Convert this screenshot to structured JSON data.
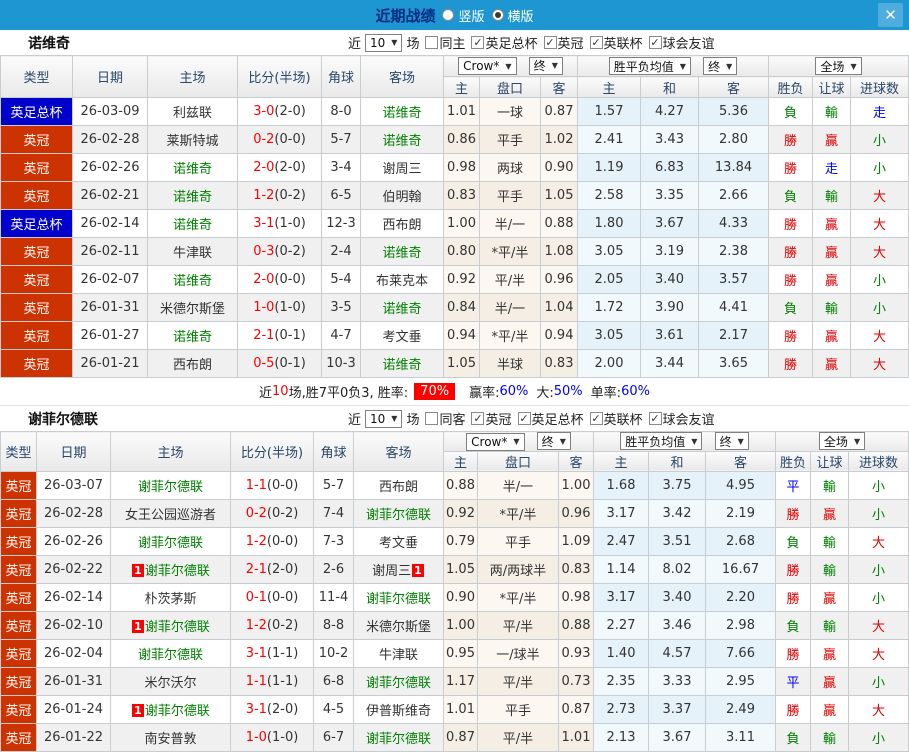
{
  "titlebar": {
    "title": "近期战绩",
    "vertical_label": "竖版",
    "horizontal_label": "横版",
    "selected_layout": "横版"
  },
  "icons": {
    "close": "✕",
    "dropdown_arrow": "▼",
    "check": "✓"
  },
  "colors": {
    "titlebar_blue": "#1e96d2",
    "league_badge_red": "#cc3301",
    "cup_badge_blue": "#0000cc",
    "self_team_green": "#008000",
    "score_red": "#ff0000",
    "win_red": "#e60000",
    "lose_green": "#008000",
    "draw_blue": "#0000ff",
    "rate_value_blue": "#0000ff",
    "win_rate_bg_red": "#ff0000"
  },
  "sections": [
    {
      "team": "诺维奇",
      "filter": {
        "near_label": "近",
        "count": "10",
        "games_label": "场",
        "same_label": "同主",
        "same_checked": false,
        "competitions": [
          "英足总杯",
          "英冠",
          "英联杯",
          "球会友谊"
        ]
      },
      "header": {
        "type": "类型",
        "date": "日期",
        "home": "主场",
        "score": "比分(半场)",
        "corner": "角球",
        "away": "客场",
        "asia_provider": "Crow*",
        "asia_stage": "终",
        "europe_provider": "胜平负均值",
        "europe_stage": "终",
        "scope": "全场",
        "asia_home": "主",
        "asia_handicap": "盘口",
        "asia_away": "客",
        "eu_home": "主",
        "eu_draw": "和",
        "eu_away": "客",
        "outcome": "胜负",
        "handicap_result": "让球",
        "goals": "进球数"
      },
      "rows": [
        {
          "league": "英足总杯",
          "league_type": "cup",
          "date": "26-03-09",
          "home": "利兹联",
          "home_self": false,
          "home_card": "",
          "score_ft": "3-0",
          "score_ht": "(2-0)",
          "corners": "8-0",
          "away": "诺维奇",
          "away_self": true,
          "away_card": "",
          "asia": [
            "1.01",
            "一球",
            "0.87"
          ],
          "europe": [
            "1.57",
            "4.27",
            "5.36"
          ],
          "results": [
            [
              "負",
              "green"
            ],
            [
              "輸",
              "green"
            ],
            [
              "走",
              "blue"
            ]
          ]
        },
        {
          "league": "英冠",
          "league_type": "league",
          "date": "26-02-28",
          "home": "莱斯特城",
          "home_self": false,
          "home_card": "",
          "score_ft": "0-2",
          "score_ht": "(0-0)",
          "corners": "5-7",
          "away": "诺维奇",
          "away_self": true,
          "away_card": "",
          "asia": [
            "0.86",
            "平手",
            "1.02"
          ],
          "europe": [
            "2.41",
            "3.43",
            "2.80"
          ],
          "results": [
            [
              "勝",
              "red"
            ],
            [
              "贏",
              "red"
            ],
            [
              "小",
              "green"
            ]
          ]
        },
        {
          "league": "英冠",
          "league_type": "league",
          "date": "26-02-26",
          "home": "诺维奇",
          "home_self": true,
          "home_card": "",
          "score_ft": "2-0",
          "score_ht": "(2-0)",
          "corners": "3-4",
          "away": "谢周三",
          "away_self": false,
          "away_card": "",
          "asia": [
            "0.98",
            "两球",
            "0.90"
          ],
          "europe": [
            "1.19",
            "6.83",
            "13.84"
          ],
          "results": [
            [
              "勝",
              "red"
            ],
            [
              "走",
              "blue"
            ],
            [
              "小",
              "green"
            ]
          ]
        },
        {
          "league": "英冠",
          "league_type": "league",
          "date": "26-02-21",
          "home": "诺维奇",
          "home_self": true,
          "home_card": "",
          "score_ft": "1-2",
          "score_ht": "(0-2)",
          "corners": "6-5",
          "away": "伯明翰",
          "away_self": false,
          "away_card": "",
          "asia": [
            "0.83",
            "平手",
            "1.05"
          ],
          "europe": [
            "2.58",
            "3.35",
            "2.66"
          ],
          "results": [
            [
              "負",
              "green"
            ],
            [
              "輸",
              "green"
            ],
            [
              "大",
              "red"
            ]
          ]
        },
        {
          "league": "英足总杯",
          "league_type": "cup",
          "date": "26-02-14",
          "home": "诺维奇",
          "home_self": true,
          "home_card": "",
          "score_ft": "3-1",
          "score_ht": "(1-0)",
          "corners": "12-3",
          "away": "西布朗",
          "away_self": false,
          "away_card": "",
          "asia": [
            "1.00",
            "半/一",
            "0.88"
          ],
          "europe": [
            "1.80",
            "3.67",
            "4.33"
          ],
          "results": [
            [
              "勝",
              "red"
            ],
            [
              "贏",
              "red"
            ],
            [
              "大",
              "red"
            ]
          ]
        },
        {
          "league": "英冠",
          "league_type": "league",
          "date": "26-02-11",
          "home": "牛津联",
          "home_self": false,
          "home_card": "",
          "score_ft": "0-3",
          "score_ht": "(0-2)",
          "corners": "2-4",
          "away": "诺维奇",
          "away_self": true,
          "away_card": "",
          "asia": [
            "0.80",
            "*平/半",
            "1.08"
          ],
          "europe": [
            "3.05",
            "3.19",
            "2.38"
          ],
          "results": [
            [
              "勝",
              "red"
            ],
            [
              "贏",
              "red"
            ],
            [
              "大",
              "red"
            ]
          ]
        },
        {
          "league": "英冠",
          "league_type": "league",
          "date": "26-02-07",
          "home": "诺维奇",
          "home_self": true,
          "home_card": "",
          "score_ft": "2-0",
          "score_ht": "(0-0)",
          "corners": "5-4",
          "away": "布莱克本",
          "away_self": false,
          "away_card": "",
          "asia": [
            "0.92",
            "平/半",
            "0.96"
          ],
          "europe": [
            "2.05",
            "3.40",
            "3.57"
          ],
          "results": [
            [
              "勝",
              "red"
            ],
            [
              "贏",
              "red"
            ],
            [
              "小",
              "green"
            ]
          ]
        },
        {
          "league": "英冠",
          "league_type": "league",
          "date": "26-01-31",
          "home": "米德尔斯堡",
          "home_self": false,
          "home_card": "",
          "score_ft": "1-0",
          "score_ht": "(1-0)",
          "corners": "3-5",
          "away": "诺维奇",
          "away_self": true,
          "away_card": "",
          "asia": [
            "0.84",
            "半/一",
            "1.04"
          ],
          "europe": [
            "1.72",
            "3.90",
            "4.41"
          ],
          "results": [
            [
              "負",
              "green"
            ],
            [
              "輸",
              "green"
            ],
            [
              "小",
              "green"
            ]
          ]
        },
        {
          "league": "英冠",
          "league_type": "league",
          "date": "26-01-27",
          "home": "诺维奇",
          "home_self": true,
          "home_card": "",
          "score_ft": "2-1",
          "score_ht": "(0-1)",
          "corners": "4-7",
          "away": "考文垂",
          "away_self": false,
          "away_card": "",
          "asia": [
            "0.94",
            "*平/半",
            "0.94"
          ],
          "europe": [
            "3.05",
            "3.61",
            "2.17"
          ],
          "results": [
            [
              "勝",
              "red"
            ],
            [
              "贏",
              "red"
            ],
            [
              "大",
              "red"
            ]
          ]
        },
        {
          "league": "英冠",
          "league_type": "league",
          "date": "26-01-21",
          "home": "西布朗",
          "home_self": false,
          "home_card": "",
          "score_ft": "0-5",
          "score_ht": "(0-1)",
          "corners": "10-3",
          "away": "诺维奇",
          "away_self": true,
          "away_card": "",
          "asia": [
            "1.05",
            "半球",
            "0.83"
          ],
          "europe": [
            "2.00",
            "3.44",
            "3.65"
          ],
          "results": [
            [
              "勝",
              "red"
            ],
            [
              "贏",
              "red"
            ],
            [
              "大",
              "red"
            ]
          ]
        }
      ],
      "summary": {
        "near": "近",
        "count": "10",
        "record": "场,胜7平0负3, 胜率:",
        "win_rate": "70%",
        "stats": [
          {
            "label": "赢率:",
            "value": "60%"
          },
          {
            "label": "大:",
            "value": "50%"
          },
          {
            "label": "单率:",
            "value": "60%"
          }
        ]
      }
    },
    {
      "team": "谢菲尔德联",
      "filter": {
        "near_label": "近",
        "count": "10",
        "games_label": "场",
        "same_label": "同客",
        "same_checked": false,
        "competitions": [
          "英冠",
          "英足总杯",
          "英联杯",
          "球会友谊"
        ]
      },
      "header": {
        "type": "类型",
        "date": "日期",
        "home": "主场",
        "score": "比分(半场)",
        "corner": "角球",
        "away": "客场",
        "asia_provider": "Crow*",
        "asia_stage": "终",
        "europe_provider": "胜平负均值",
        "europe_stage": "终",
        "scope": "全场",
        "asia_home": "主",
        "asia_handicap": "盘口",
        "asia_away": "客",
        "eu_home": "主",
        "eu_draw": "和",
        "eu_away": "客",
        "outcome": "胜负",
        "handicap_result": "让球",
        "goals": "进球数"
      },
      "rows": [
        {
          "league": "英冠",
          "league_type": "league",
          "date": "26-03-07",
          "home": "谢菲尔德联",
          "home_self": true,
          "home_card": "",
          "score_ft": "1-1",
          "score_ht": "(0-0)",
          "corners": "5-7",
          "away": "西布朗",
          "away_self": false,
          "away_card": "",
          "asia": [
            "0.88",
            "半/一",
            "1.00"
          ],
          "europe": [
            "1.68",
            "3.75",
            "4.95"
          ],
          "results": [
            [
              "平",
              "blue"
            ],
            [
              "輸",
              "green"
            ],
            [
              "小",
              "green"
            ]
          ]
        },
        {
          "league": "英冠",
          "league_type": "league",
          "date": "26-02-28",
          "home": "女王公园巡游者",
          "home_self": false,
          "home_card": "",
          "score_ft": "0-2",
          "score_ht": "(0-2)",
          "corners": "7-4",
          "away": "谢菲尔德联",
          "away_self": true,
          "away_card": "",
          "asia": [
            "0.92",
            "*平/半",
            "0.96"
          ],
          "europe": [
            "3.17",
            "3.42",
            "2.19"
          ],
          "results": [
            [
              "勝",
              "red"
            ],
            [
              "贏",
              "red"
            ],
            [
              "小",
              "green"
            ]
          ]
        },
        {
          "league": "英冠",
          "league_type": "league",
          "date": "26-02-26",
          "home": "谢菲尔德联",
          "home_self": true,
          "home_card": "",
          "score_ft": "1-2",
          "score_ht": "(0-0)",
          "corners": "7-3",
          "away": "考文垂",
          "away_self": false,
          "away_card": "",
          "asia": [
            "0.79",
            "平手",
            "1.09"
          ],
          "europe": [
            "2.47",
            "3.51",
            "2.68"
          ],
          "results": [
            [
              "負",
              "green"
            ],
            [
              "輸",
              "green"
            ],
            [
              "大",
              "red"
            ]
          ]
        },
        {
          "league": "英冠",
          "league_type": "league",
          "date": "26-02-22",
          "home": "谢菲尔德联",
          "home_self": true,
          "home_card": "1",
          "score_ft": "2-1",
          "score_ht": "(2-0)",
          "corners": "2-6",
          "away": "谢周三",
          "away_self": false,
          "away_card": "1",
          "asia": [
            "1.05",
            "两/两球半",
            "0.83"
          ],
          "europe": [
            "1.14",
            "8.02",
            "16.67"
          ],
          "results": [
            [
              "勝",
              "red"
            ],
            [
              "輸",
              "green"
            ],
            [
              "小",
              "green"
            ]
          ]
        },
        {
          "league": "英冠",
          "league_type": "league",
          "date": "26-02-14",
          "home": "朴茨茅斯",
          "home_self": false,
          "home_card": "",
          "score_ft": "0-1",
          "score_ht": "(0-0)",
          "corners": "11-4",
          "away": "谢菲尔德联",
          "away_self": true,
          "away_card": "",
          "asia": [
            "0.90",
            "*平/半",
            "0.98"
          ],
          "europe": [
            "3.17",
            "3.40",
            "2.20"
          ],
          "results": [
            [
              "勝",
              "red"
            ],
            [
              "贏",
              "red"
            ],
            [
              "小",
              "green"
            ]
          ]
        },
        {
          "league": "英冠",
          "league_type": "league",
          "date": "26-02-10",
          "home": "谢菲尔德联",
          "home_self": true,
          "home_card": "1",
          "score_ft": "1-2",
          "score_ht": "(0-2)",
          "corners": "8-8",
          "away": "米德尔斯堡",
          "away_self": false,
          "away_card": "",
          "asia": [
            "1.00",
            "平/半",
            "0.88"
          ],
          "europe": [
            "2.27",
            "3.46",
            "2.98"
          ],
          "results": [
            [
              "負",
              "green"
            ],
            [
              "輸",
              "green"
            ],
            [
              "大",
              "red"
            ]
          ]
        },
        {
          "league": "英冠",
          "league_type": "league",
          "date": "26-02-04",
          "home": "谢菲尔德联",
          "home_self": true,
          "home_card": "",
          "score_ft": "3-1",
          "score_ht": "(1-1)",
          "corners": "10-2",
          "away": "牛津联",
          "away_self": false,
          "away_card": "",
          "asia": [
            "0.95",
            "一/球半",
            "0.93"
          ],
          "europe": [
            "1.40",
            "4.57",
            "7.66"
          ],
          "results": [
            [
              "勝",
              "red"
            ],
            [
              "贏",
              "red"
            ],
            [
              "大",
              "red"
            ]
          ]
        },
        {
          "league": "英冠",
          "league_type": "league",
          "date": "26-01-31",
          "home": "米尔沃尔",
          "home_self": false,
          "home_card": "",
          "score_ft": "1-1",
          "score_ht": "(1-1)",
          "corners": "6-8",
          "away": "谢菲尔德联",
          "away_self": true,
          "away_card": "",
          "asia": [
            "1.17",
            "平/半",
            "0.73"
          ],
          "europe": [
            "2.35",
            "3.33",
            "2.95"
          ],
          "results": [
            [
              "平",
              "blue"
            ],
            [
              "贏",
              "red"
            ],
            [
              "小",
              "green"
            ]
          ]
        },
        {
          "league": "英冠",
          "league_type": "league",
          "date": "26-01-24",
          "home": "谢菲尔德联",
          "home_self": true,
          "home_card": "1",
          "score_ft": "3-1",
          "score_ht": "(2-0)",
          "corners": "4-5",
          "away": "伊普斯维奇",
          "away_self": false,
          "away_card": "",
          "asia": [
            "1.01",
            "平手",
            "0.87"
          ],
          "europe": [
            "2.73",
            "3.37",
            "2.49"
          ],
          "results": [
            [
              "勝",
              "red"
            ],
            [
              "贏",
              "red"
            ],
            [
              "大",
              "red"
            ]
          ]
        },
        {
          "league": "英冠",
          "league_type": "league",
          "date": "26-01-22",
          "home": "南安普敦",
          "home_self": false,
          "home_card": "",
          "score_ft": "1-0",
          "score_ht": "(1-0)",
          "corners": "6-7",
          "away": "谢菲尔德联",
          "away_self": true,
          "away_card": "",
          "asia": [
            "0.87",
            "平/半",
            "1.01"
          ],
          "europe": [
            "2.13",
            "3.67",
            "3.11"
          ],
          "results": [
            [
              "負",
              "green"
            ],
            [
              "輸",
              "green"
            ],
            [
              "小",
              "green"
            ]
          ]
        }
      ]
    }
  ]
}
